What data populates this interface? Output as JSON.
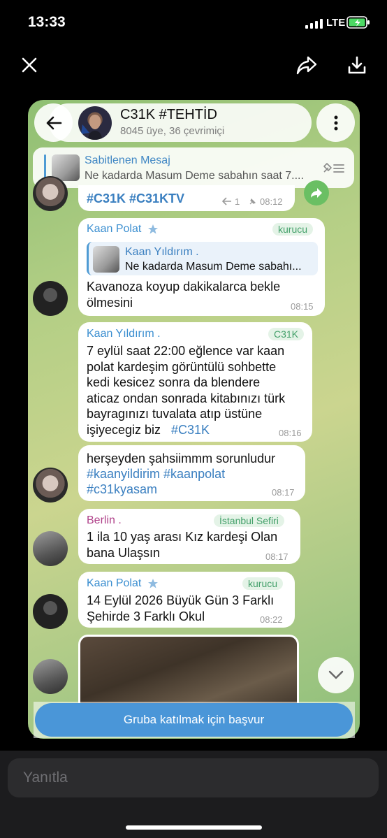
{
  "status_bar": {
    "time": "13:33",
    "network": "LTE"
  },
  "viewer": {
    "close_icon": "close-icon",
    "share_icon": "share-icon",
    "download_icon": "download-icon"
  },
  "group": {
    "title": "C31K #TEHTİD",
    "subtitle": "8045 üye, 36 çevrimiçi"
  },
  "pinned": {
    "title": "Sabitlenen Mesaj",
    "text": "Ne kadarda Masum Deme sabahın saat 7...."
  },
  "messages": [
    {
      "text": "#C31K #C31KTV",
      "replies": "1",
      "time": "08:12"
    },
    {
      "sender": "Kaan Polat",
      "role": "kurucu",
      "reply_sender": "Kaan Yıldırım .",
      "reply_text": "Ne kadarda Masum Deme sabahı...",
      "text": "Kavanoza koyup dakikalarca bekle\nölmesini",
      "time": "08:15"
    },
    {
      "sender": "Kaan Yıldırım .",
      "role": "C31K",
      "text": "7 eylül saat 22:00 eğlence var kaan\npolat kardeşim görüntülü sohbette\nkedi kesicez sonra da blendere\naticaz ondan sonrada kitabınızı türk\nbayragınızı tuvalata atıp üstüne\nişiyecegiz biz",
      "tag": "#C31K",
      "time": "08:16"
    },
    {
      "line1": "herşeyden şahsiimmm sorunludur",
      "tags_line1": "#kaanyildirim #kaanpolat",
      "tags_line2": "#c31kyasam",
      "time": "08:17"
    },
    {
      "sender": "Berlin .",
      "role": "İstanbul Sefiri",
      "text": "1 ila 10 yaş arası Kız kardeşi Olan\nbana Ulaşsın",
      "time": "08:17"
    },
    {
      "sender": "Kaan Polat",
      "role": "kurucu",
      "text": "14 Eylül 2026 Büyük Gün 3 Farklı\nŞehirde 3 Farklı Okul",
      "time": "08:22"
    }
  ],
  "join_button": "Gruba katılmak için başvur",
  "reply_placeholder": "Yanıtla",
  "colors": {
    "accent": "#4a96d8",
    "link": "#3a7fc0",
    "role_green": "#43a06a",
    "berlin_pink": "#b0428a"
  }
}
